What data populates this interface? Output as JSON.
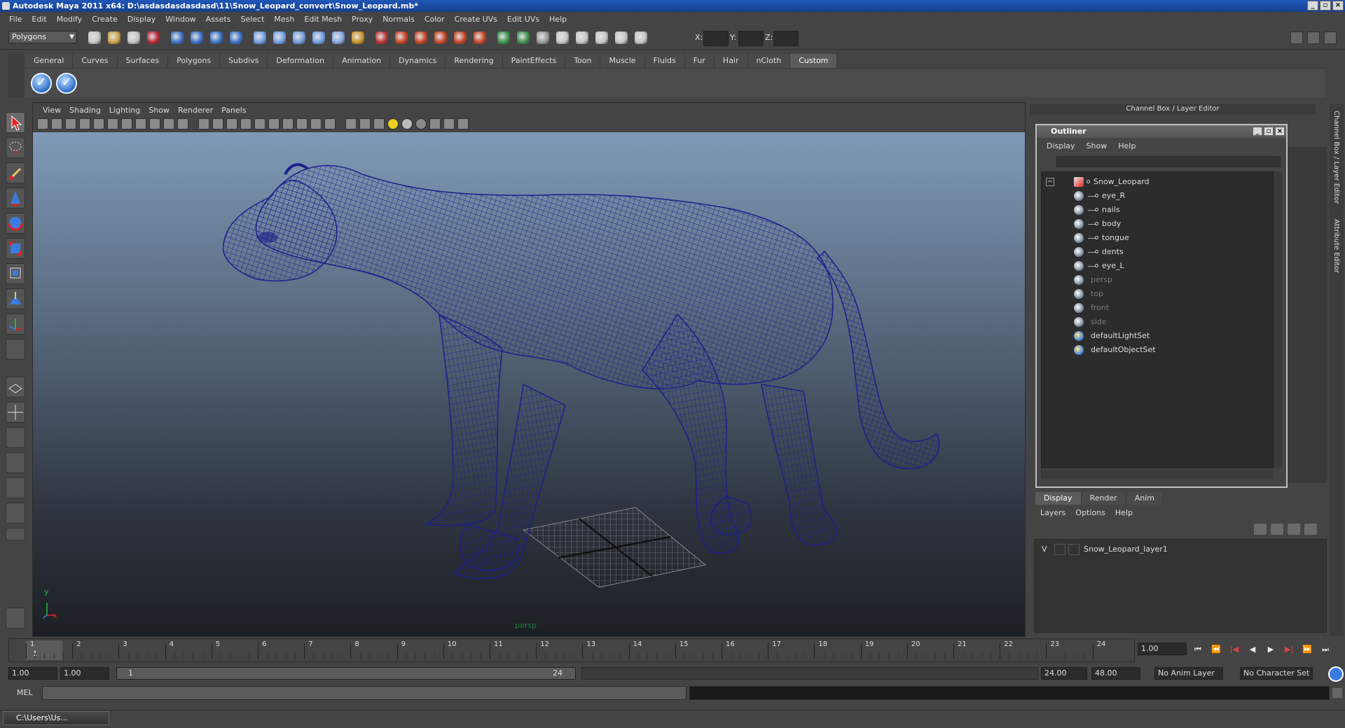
{
  "window": {
    "title": "Autodesk Maya 2011 x64: D:\\asdasdasdasdasd\\11\\Snow_Leopard_convert\\Snow_Leopard.mb*"
  },
  "menubar": [
    "File",
    "Edit",
    "Modify",
    "Create",
    "Display",
    "Window",
    "Assets",
    "Select",
    "Mesh",
    "Edit Mesh",
    "Proxy",
    "Normals",
    "Color",
    "Create UVs",
    "Edit UVs",
    "Help"
  ],
  "statusline": {
    "mode": "Polygons",
    "x_label": "X:",
    "y_label": "Y:",
    "z_label": "Z:"
  },
  "shelf": {
    "tabs": [
      "General",
      "Curves",
      "Surfaces",
      "Polygons",
      "Subdivs",
      "Deformation",
      "Animation",
      "Dynamics",
      "Rendering",
      "PaintEffects",
      "Toon",
      "Muscle",
      "Fluids",
      "Fur",
      "Hair",
      "nCloth",
      "Custom"
    ],
    "active_tab": "Custom"
  },
  "viewport": {
    "menu": [
      "View",
      "Shading",
      "Lighting",
      "Show",
      "Renderer",
      "Panels"
    ],
    "camera_label": "persp",
    "axis_x": "x",
    "axis_y": "y",
    "wireframe_color": "#1d1f8c"
  },
  "right_panel": {
    "header": "Channel Box / Layer Editor",
    "side_tabs": [
      "Channel Box / Layer Editor",
      "Attribute Editor"
    ]
  },
  "outliner": {
    "title": "Outliner",
    "menu": [
      "Display",
      "Show",
      "Help"
    ],
    "items": [
      {
        "label": "Snow_Leopard",
        "level": 0,
        "dim": false
      },
      {
        "label": "eye_R",
        "level": 1,
        "dim": false
      },
      {
        "label": "nails",
        "level": 1,
        "dim": false
      },
      {
        "label": "body",
        "level": 1,
        "dim": false
      },
      {
        "label": "tongue",
        "level": 1,
        "dim": false
      },
      {
        "label": "dents",
        "level": 1,
        "dim": false
      },
      {
        "label": "eye_L",
        "level": 1,
        "dim": false
      },
      {
        "label": "persp",
        "level": 0,
        "dim": true
      },
      {
        "label": "top",
        "level": 0,
        "dim": true
      },
      {
        "label": "front",
        "level": 0,
        "dim": true
      },
      {
        "label": "side",
        "level": 0,
        "dim": true
      },
      {
        "label": "defaultLightSet",
        "level": 0,
        "dim": false
      },
      {
        "label": "defaultObjectSet",
        "level": 0,
        "dim": false
      }
    ]
  },
  "layer_editor": {
    "tabs": [
      "Display",
      "Render",
      "Anim"
    ],
    "active_tab": "Display",
    "menu": [
      "Layers",
      "Options",
      "Help"
    ],
    "layers": [
      {
        "visible": "V",
        "name": "Snow_Leopard_layer1"
      }
    ]
  },
  "time_slider": {
    "ticks": [
      "1",
      "2",
      "3",
      "4",
      "5",
      "6",
      "7",
      "8",
      "9",
      "10",
      "11",
      "12",
      "13",
      "14",
      "15",
      "16",
      "17",
      "18",
      "19",
      "20",
      "21",
      "22",
      "23",
      "24"
    ],
    "current_marker": "1",
    "current_frame": "1.00"
  },
  "range_slider": {
    "start_time": "1.00",
    "playback_start": "1.00",
    "range_start": "1",
    "range_end": "24",
    "playback_end": "24.00",
    "end_time": "48.00",
    "anim_layer": "No Anim Layer",
    "character_set": "No Character Set"
  },
  "command_line": {
    "label": "MEL"
  },
  "taskbar": {
    "item": "C:\\Users\\Us..."
  }
}
